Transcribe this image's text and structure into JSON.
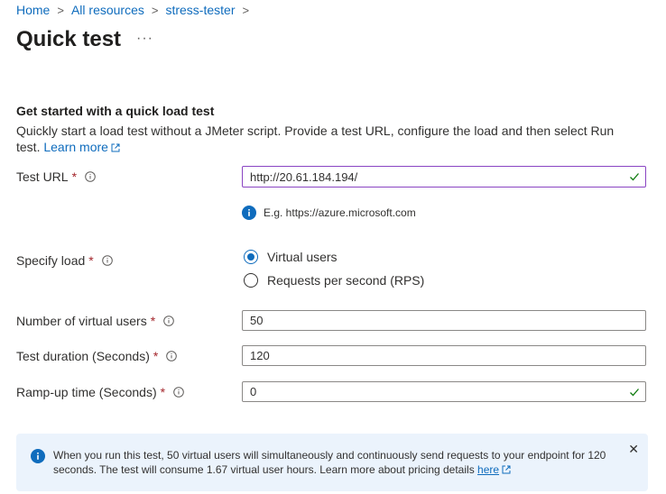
{
  "breadcrumb": [
    "Home",
    "All resources",
    "stress-tester"
  ],
  "page": {
    "title": "Quick test",
    "more": "···"
  },
  "section": {
    "heading": "Get started with a quick load test",
    "description": "Quickly start a load test without a JMeter script. Provide a test URL, configure the load and then select Run test.",
    "learn_more": "Learn more"
  },
  "form": {
    "test_url": {
      "label": "Test URL",
      "required": "*",
      "value": "http://20.61.184.194/",
      "hint": "E.g. https://azure.microsoft.com"
    },
    "specify_load": {
      "label": "Specify load",
      "required": "*",
      "options": [
        "Virtual users",
        "Requests per second (RPS)"
      ],
      "selected": "Virtual users"
    },
    "virtual_users": {
      "label": "Number of virtual users",
      "required": "*",
      "value": "50"
    },
    "duration": {
      "label": "Test duration (Seconds)",
      "required": "*",
      "value": "120"
    },
    "rampup": {
      "label": "Ramp-up time (Seconds)",
      "required": "*",
      "value": "0"
    }
  },
  "banner": {
    "text": "When you run this test, 50 virtual users will simultaneously and continuously send requests to your endpoint for 120 seconds. The test will consume 1.67 virtual user hours. Learn more about pricing details",
    "link": "here",
    "close": "✕"
  },
  "colors": {
    "accent": "#0f6cbd",
    "required": "#a4262c",
    "success": "#107c10",
    "focus_border": "#8a44c3",
    "banner_bg": "#ebf3fc"
  }
}
